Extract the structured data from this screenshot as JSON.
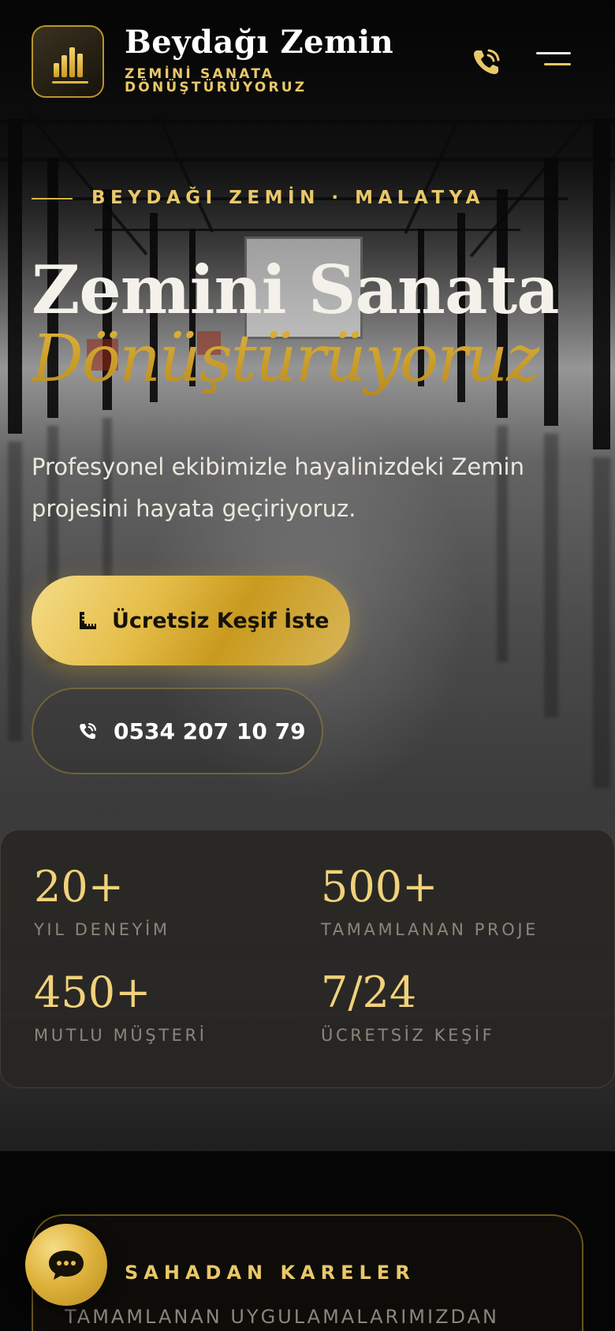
{
  "header": {
    "brand_title": "Beydağı Zemin",
    "brand_tagline": "ZEMİNİ SANATA DÖNÜŞTÜRÜYORUZ",
    "logo_icon": "bar-chart-icon",
    "phone_icon": "phone-ringing-icon",
    "menu_icon": "hamburger-menu-icon"
  },
  "hero": {
    "eyebrow": "BEYDAĞI ZEMİN · MALATYA",
    "headline_line1": "Zemini Sanata",
    "headline_line2": "Dönüştürüyoruz",
    "lead": "Profesyonel ekibimizle hayalinizdeki Zemin projesini hayata geçiriyoruz.",
    "cta_primary": {
      "label": "Ücretsiz Keşif İste",
      "icon": "ruler-icon"
    },
    "cta_secondary": {
      "label": "0534 207 10 79",
      "icon": "phone-ringing-icon"
    }
  },
  "stats": [
    {
      "value": "20+",
      "label": "YIL DENEYİM"
    },
    {
      "value": "500+",
      "label": "TAMAMLANAN PROJE"
    },
    {
      "value": "450+",
      "label": "MUTLU MÜŞTERİ"
    },
    {
      "value": "7/24",
      "label": "ÜCRETSİZ KEŞİF"
    }
  ],
  "gallery": {
    "title": "SAHADAN KARELER",
    "subtitle": "TAMAMLANAN UYGULAMALARIMIZDAN"
  },
  "chat": {
    "icon": "chat-bubble-icon"
  },
  "colors": {
    "gold": "#e9c86a",
    "gold_dark": "#c99a1e",
    "stats_bg": "#2a2825",
    "muted_text": "#8b857a"
  }
}
